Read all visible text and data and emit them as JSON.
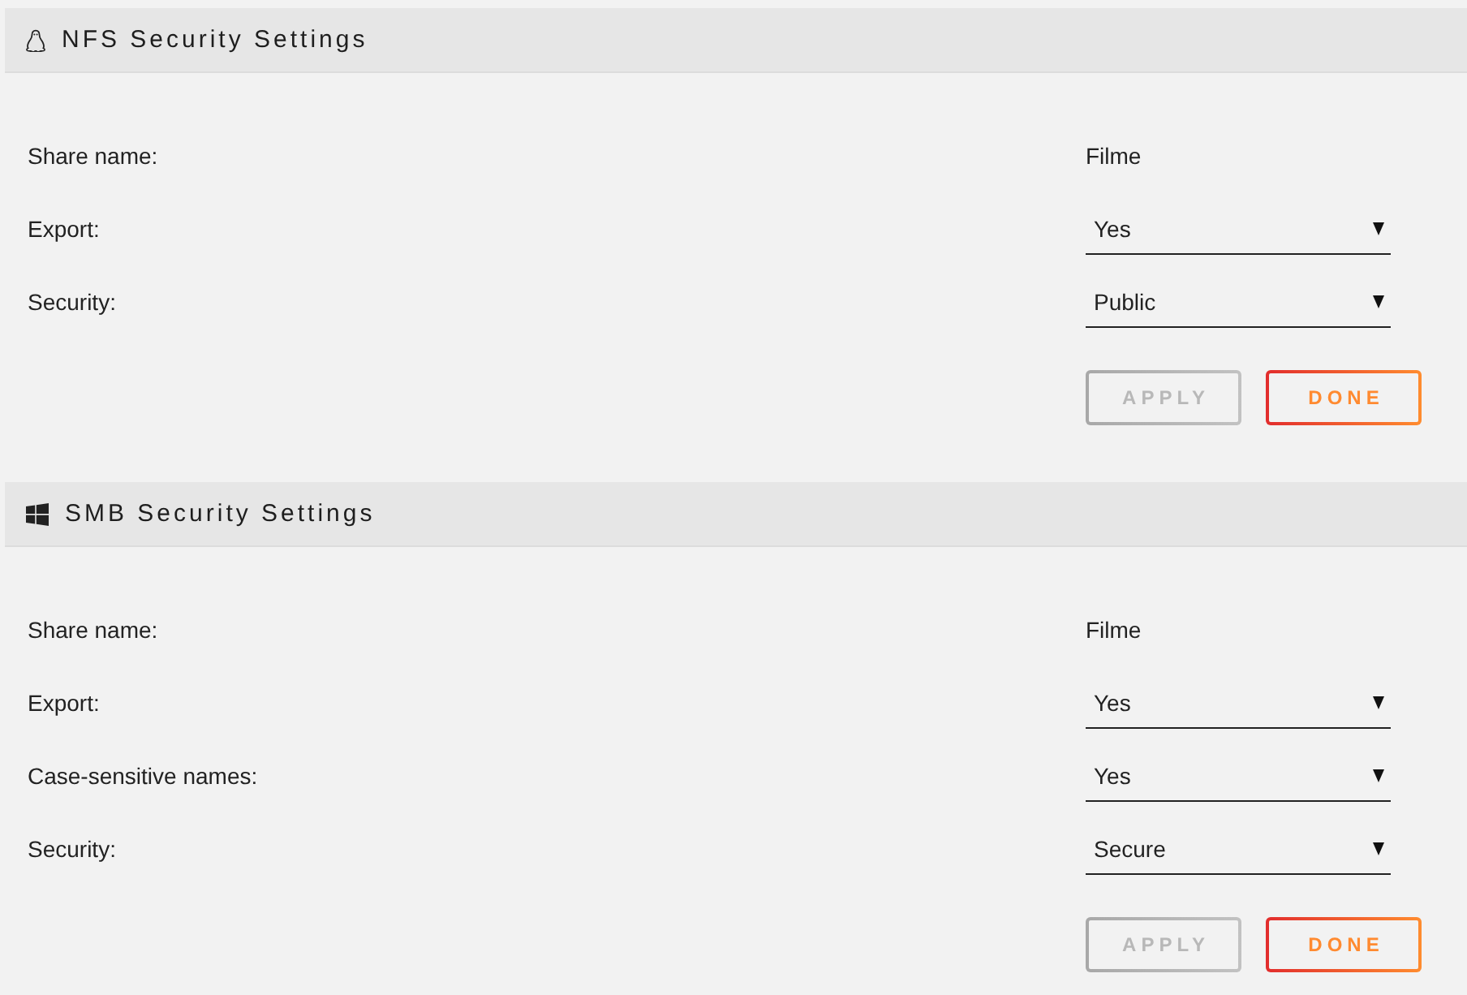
{
  "sections": [
    {
      "kind": "nfs",
      "title": "NFS Security Settings",
      "rows": [
        {
          "kind": "text",
          "label": "Share name:",
          "value": "Filme"
        },
        {
          "kind": "select",
          "label": "Export:",
          "value": "Yes"
        },
        {
          "kind": "select",
          "label": "Security:",
          "value": "Public"
        }
      ],
      "buttons": [
        {
          "label": "APPLY",
          "disabled": true
        },
        {
          "label": "DONE",
          "disabled": false
        }
      ]
    },
    {
      "kind": "smb",
      "title": "SMB Security Settings",
      "rows": [
        {
          "kind": "text",
          "label": "Share name:",
          "value": "Filme"
        },
        {
          "kind": "select",
          "label": "Export:",
          "value": "Yes"
        },
        {
          "kind": "select",
          "label": "Case-sensitive names:",
          "value": "Yes"
        },
        {
          "kind": "select",
          "label": "Security:",
          "value": "Secure"
        }
      ],
      "buttons": [
        {
          "label": "APPLY",
          "disabled": true
        },
        {
          "label": "DONE",
          "disabled": false
        }
      ]
    }
  ]
}
